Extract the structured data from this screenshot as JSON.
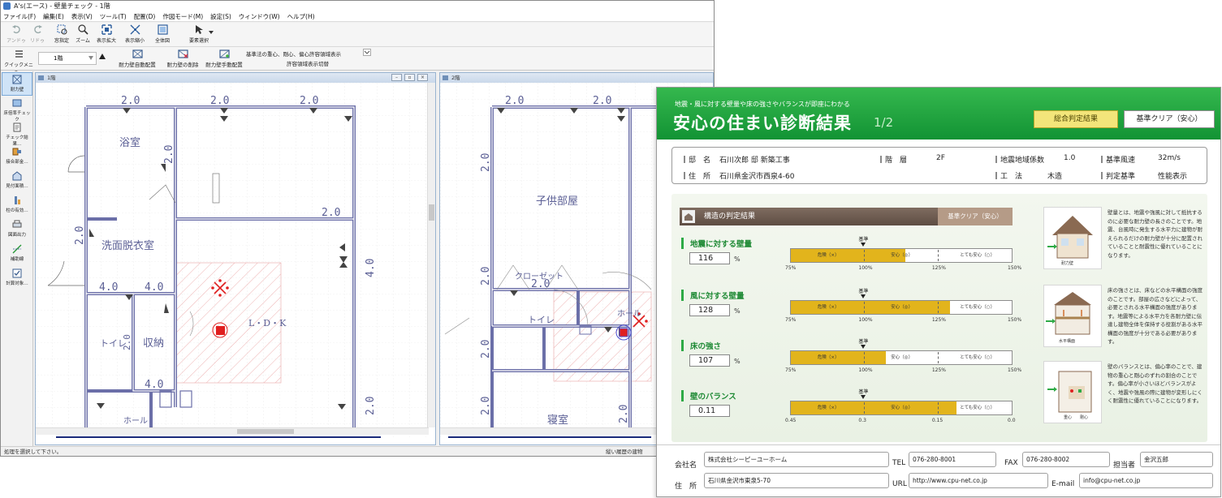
{
  "window": {
    "title": "A's(エース) - 壁量チェック - 1階",
    "menu": [
      "ファイル(F)",
      "編集(E)",
      "表示(V)",
      "ツール(T)",
      "配置(D)",
      "作図モード(M)",
      "設定(S)",
      "ウィンドウ(W)",
      "ヘルプ(H)"
    ]
  },
  "toolbar": {
    "undo": "アンドゥ",
    "redo": "リドゥ",
    "window_select": "窓指定",
    "zoom": "ズーム",
    "zoom_in": "表示拡大",
    "zoom_out": "表示縮小",
    "fit_all": "全体図",
    "element_select": "要素選択",
    "quick_menu": "クイックメニュー",
    "floor": "1階",
    "auto_place": "耐力壁自動配置",
    "delete_wall": "耐力壁の削除",
    "manual_place": "耐力壁手動配置",
    "display_option": "基準法の重心、剛心、偏心許容領域表示",
    "toggle_label": "許容領域表示切替"
  },
  "sidebar": [
    "耐力壁",
    "床倍率チェック",
    "チェック結果…",
    "接合部金…",
    "見付面積…",
    "柱の有効…",
    "図面出力",
    "補助線",
    "計算対象…"
  ],
  "plan1": {
    "title": "1階",
    "rooms": [
      "浴室",
      "洗面脱衣室",
      "トイレ",
      "収納",
      "L・D・K",
      "ホール"
    ],
    "dims": [
      "2.0",
      "2.0",
      "2.0",
      "2.0",
      "2.0",
      "2.0",
      "2.0",
      "4.0",
      "4.0",
      "4.0",
      "4.0",
      "2.0",
      "2.0"
    ]
  },
  "plan2": {
    "title": "2階",
    "rooms": [
      "子供部屋",
      "クローゼット",
      "トイレ",
      "ホール",
      "寝室"
    ],
    "dims": [
      "2.0",
      "2.0",
      "2.0",
      "2.0",
      "2.0",
      "2.0",
      "2.0",
      "2.0"
    ]
  },
  "status": {
    "message": "処理を選択して下さい。",
    "right": "縦い履歴の建物"
  },
  "report": {
    "subtitle": "地震・風に対する壁量や床の強さやバランスが即座にわかる",
    "title": "安心の住まい診断結果",
    "page": "1/2",
    "tab_overall": "総合判定結果",
    "tab_standard": "基準クリア（安心）",
    "info": {
      "owner_label": "邸　名",
      "owner": "石川次郎 邸 新築工事",
      "floor_label": "階　層",
      "floor": "2F",
      "seismic_label": "地震地域係数",
      "seismic": "1.0",
      "wind_label": "基準風速",
      "wind": "32m/s",
      "address_label": "住　所",
      "address": "石川県金沢市西泉4-60",
      "method_label": "工　法",
      "method": "木造",
      "criteria_label": "判定基準",
      "criteria": "性能表示"
    },
    "section_title": "構造の判定結果",
    "section_badge": "基準クリア（安心）",
    "std_label": "基準",
    "gauges": [
      {
        "title": "地震に対する壁量",
        "value": "116",
        "unit": "%",
        "fill": 0.52,
        "zones": [
          "危険（×）",
          "安心（◎）",
          "とても安心（○）"
        ],
        "ticks": [
          "75%",
          "100%",
          "125%",
          "150%"
        ]
      },
      {
        "title": "風に対する壁量",
        "value": "128",
        "unit": "%",
        "fill": 0.72,
        "zones": [
          "危険（×）",
          "安心（◎）",
          "とても安心（○）"
        ],
        "ticks": [
          "75%",
          "100%",
          "125%",
          "150%"
        ]
      },
      {
        "title": "床の強さ",
        "value": "107",
        "unit": "%",
        "fill": 0.43,
        "zones": [
          "危険（×）",
          "安心（◎）",
          "とても安心（○）"
        ],
        "ticks": [
          "75%",
          "100%",
          "125%",
          "150%"
        ]
      },
      {
        "title": "壁のバランス",
        "value": "0.11",
        "unit": "",
        "fill": 0.75,
        "zones": [
          "危険（×）",
          "安心（◎）",
          "とても安心（○）"
        ],
        "ticks": [
          "0.45",
          "0.3",
          "0.15",
          "0.0"
        ]
      }
    ],
    "descriptions": [
      "壁量とは、地震や強風に対して抵抗するのに必要な耐力壁の長さのことです。地震、台風時に発生する水平力に建物が耐えられるだけの耐力壁が十分に配置されていることと耐震性に優れていることになります。",
      "床の強さとは、床などの水平構面の強度のことです。部屋の広さなどによって、必要とされる水平構面の強度があります。地震等による水平力を各耐力壁に伝達し建物全体を保持する役割がある水平構面の強度が十分である必要があります。",
      "壁のバランスとは、偏心率のことで、建物の重心と剛心のずれの割合のことです。偏心率が小さいほどバランスがよく、地震や強風の際に建物が変形しにくく耐震性に優れていることになります。"
    ],
    "illus_labels": [
      "耐力壁",
      "水平構面",
      "重心",
      "剛心"
    ],
    "footer": {
      "company_label": "会社名",
      "company": "株式会社シーピーユーホーム",
      "tel_label": "TEL",
      "tel": "076-280-8001",
      "fax_label": "FAX",
      "fax": "076-280-8002",
      "person_label": "担当者",
      "person": "金沢五郎",
      "address_label": "住　所",
      "address": "石川県金沢市東泉5-70",
      "url_label": "URL",
      "url": "http://www.cpu-net.co.jp",
      "email_label": "E-mail",
      "email": "info@cpu-net.co.jp"
    }
  },
  "colors": {
    "header_green": "#129334",
    "gauge_fill": "#e2b41c",
    "wall": "#6b6fa8",
    "hatch": "#e48b8b",
    "marker_red": "#e02020"
  }
}
